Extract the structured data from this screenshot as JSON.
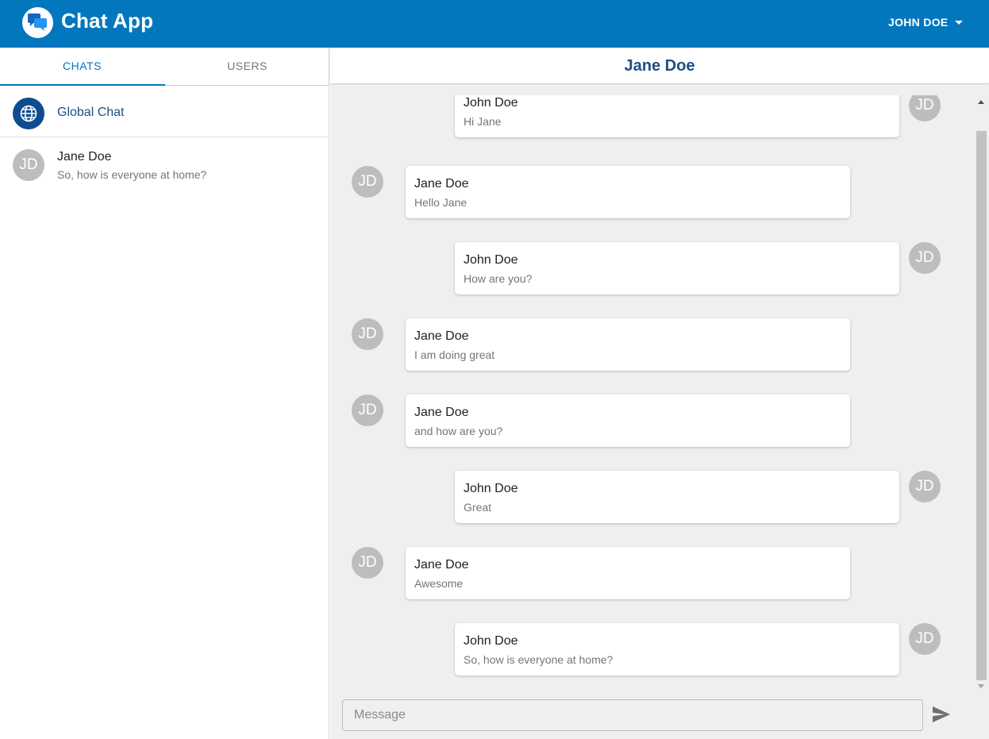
{
  "app": {
    "title": "Chat App",
    "logo_icon": "chat-bubbles-icon",
    "user_menu_label": "JOHN DOE",
    "user_menu_icon": "caret-down-icon",
    "brand_color": "#0277bd"
  },
  "sidebar": {
    "tabs": [
      {
        "label": "CHATS",
        "active": true
      },
      {
        "label": "USERS",
        "active": false
      }
    ],
    "chats": [
      {
        "name": "Global Chat",
        "icon": "globe-icon"
      },
      {
        "avatar": "JD",
        "name": "Jane Doe",
        "preview": "So, how is everyone at home?"
      }
    ]
  },
  "chat": {
    "title": "Jane Doe",
    "messages": [
      {
        "side": "right",
        "avatar": "JD",
        "sender": "John Doe",
        "text": "Hi Jane"
      },
      {
        "side": "left",
        "avatar": "JD",
        "sender": "Jane Doe",
        "text": "Hello Jane"
      },
      {
        "side": "right",
        "avatar": "JD",
        "sender": "John Doe",
        "text": "How are you?"
      },
      {
        "side": "left",
        "avatar": "JD",
        "sender": "Jane Doe",
        "text": "I am doing great"
      },
      {
        "side": "left",
        "avatar": "JD",
        "sender": "Jane Doe",
        "text": "and how are you?"
      },
      {
        "side": "right",
        "avatar": "JD",
        "sender": "John Doe",
        "text": "Great"
      },
      {
        "side": "left",
        "avatar": "JD",
        "sender": "Jane Doe",
        "text": "Awesome"
      },
      {
        "side": "right",
        "avatar": "JD",
        "sender": "John Doe",
        "text": "So, how is everyone at home?"
      }
    ],
    "input": {
      "placeholder": "Message",
      "value": ""
    },
    "send_icon": "send-icon"
  }
}
